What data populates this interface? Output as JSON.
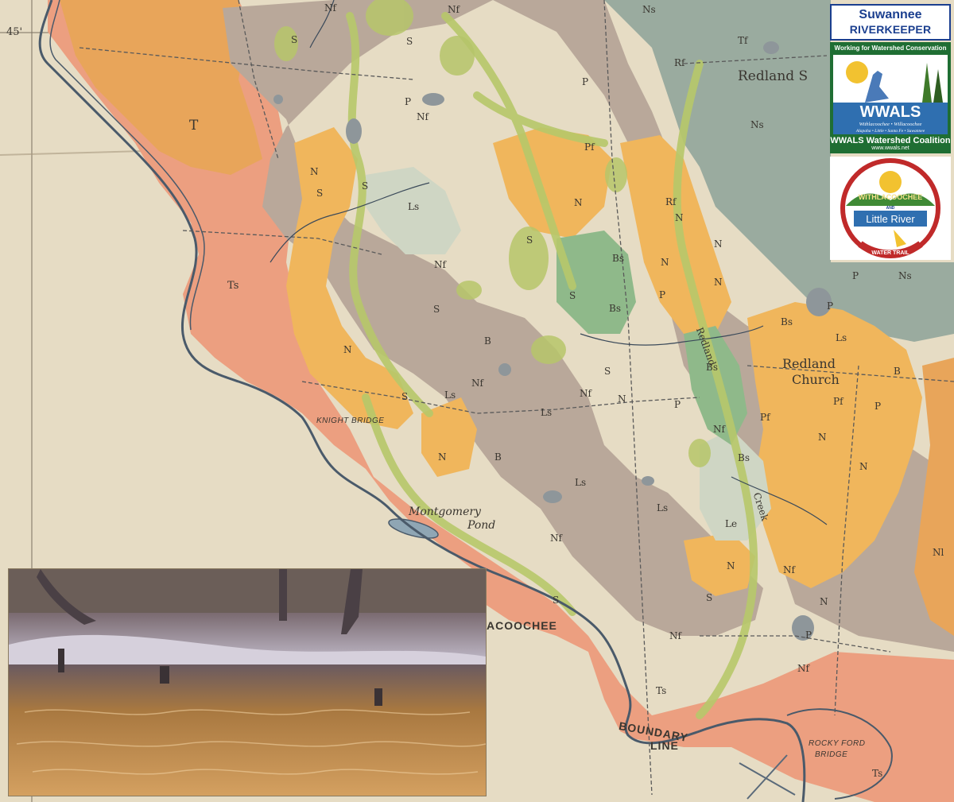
{
  "map": {
    "coordinate_label": "45'",
    "formation_labels": {
      "t": "T",
      "ts": "Ts",
      "n": "N",
      "nf": "Nf",
      "s": "S",
      "ls": "Ls",
      "b": "B",
      "bs": "Bs",
      "p": "P",
      "pf": "Pf",
      "rf": "Rf",
      "tf": "Tf",
      "ns": "Ns",
      "nl": "Nl",
      "le": "Le"
    },
    "places": {
      "redland_s": "Redland S",
      "redland_church": "Redland\nChurch",
      "redland_church_line1": "Redland",
      "redland_church_line2": "Church",
      "redland_creek": "Redland",
      "creek": "Creek",
      "knight_bridge": "KNIGHT BRIDGE",
      "montgomery_pond_line1": "Montgomery",
      "montgomery_pond_line2": "Pond",
      "river_fragment": "ACOOCHEE",
      "boundary_line1": "BOUNDARY",
      "boundary_line2": "LINE",
      "rocky_ford_line1": "ROCKY FORD",
      "rocky_ford_line2": "BRIDGE"
    },
    "colors": {
      "paper": "#e6dcc4",
      "ts_salmon": "#ec9f80",
      "orange_t": "#e8a55a",
      "n_yellow": "#f0b65c",
      "nf_gray": "#b9a89a",
      "ns_bluegray": "#9aab9f",
      "swamp_green": "#c3cf78",
      "ls_light": "#cfd6c4",
      "river_blue": "#4a5a6a"
    }
  },
  "logos": {
    "riverkeeper_line1": "Suwannee",
    "riverkeeper_line2": "RIVERKEEPER",
    "wwals_tagline": "Working for Watershed Conservation",
    "wwals_name": "WWALS",
    "wwals_rivers_line1": "Withlacoochee • Willacoochee",
    "wwals_rivers_line2": "Alapaha • Little • Santa Fe • Suwannee",
    "wwals_coalition": "WWALS Watershed Coalition",
    "wwals_url": "www.wwals.net",
    "trail_top": "WITHLACOOCHEE",
    "trail_and": "AND",
    "trail_middle": "Little River",
    "trail_bottom": "WATER TRAIL"
  }
}
